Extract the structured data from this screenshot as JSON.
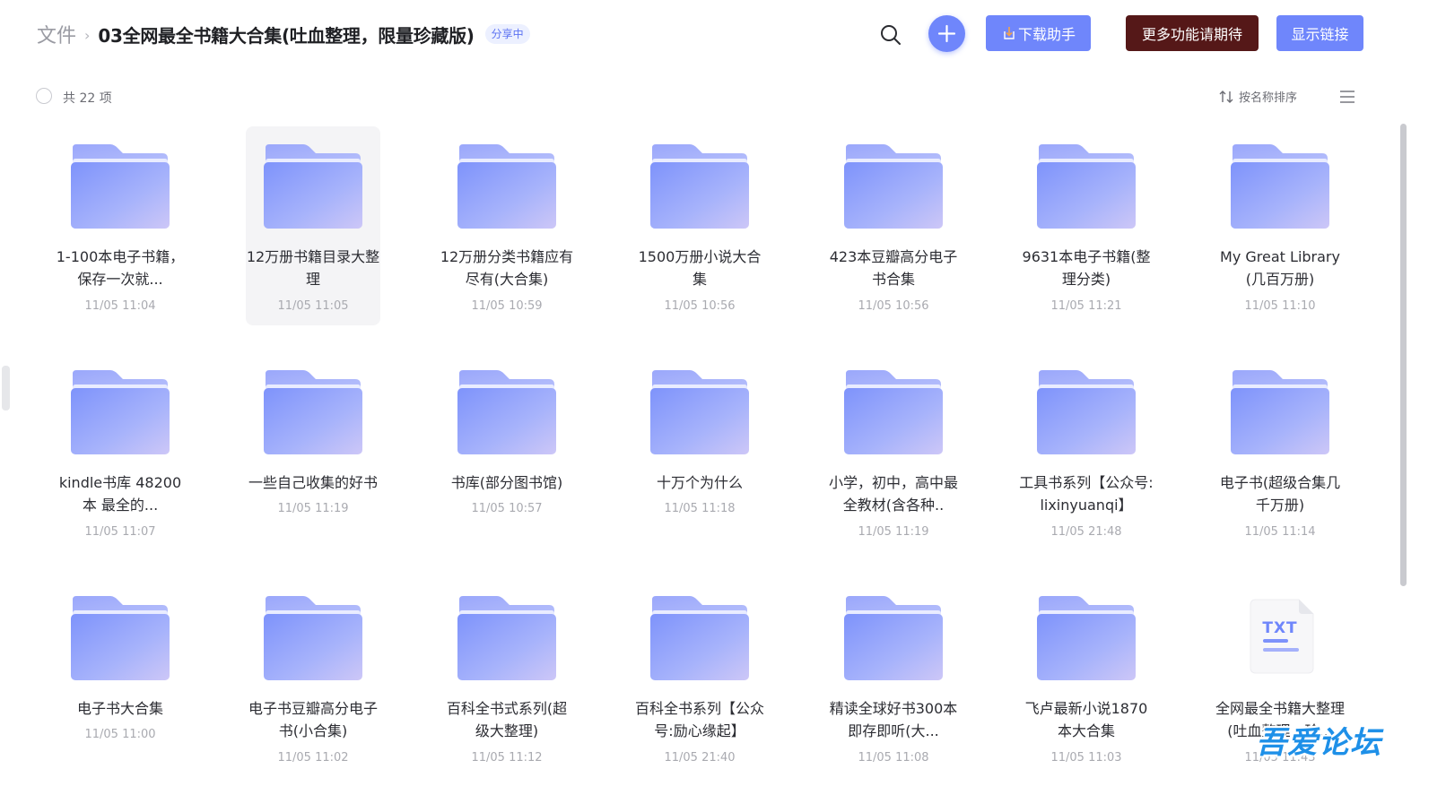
{
  "colors": {
    "accent": "#6f86fb",
    "more_button": "#551818",
    "badge_bg": "#ecf0ff",
    "badge_text": "#5c72f2",
    "folder_light": "#a5b1fb",
    "folder_front": "#7d92fb"
  },
  "breadcrumb": {
    "root": "文件",
    "separator": "›",
    "current": "03全网最全书籍大合集(吐血整理，限量珍藏版)",
    "badge": "分享中"
  },
  "header": {
    "search_icon": "search-icon",
    "add_icon": "plus-icon",
    "download_label": "下载助手",
    "more_label": "更多功能请期待",
    "link_label": "显示链接"
  },
  "toolbar": {
    "total": "共 22 项",
    "sort_label": "按名称排序",
    "sort_icon": "sort-arrows-icon",
    "view_icon": "list-view-icon"
  },
  "items": [
    {
      "name": "1-100本电子书籍，保存一次就...",
      "date": "11/05 11:04",
      "type": "folder"
    },
    {
      "name": "12万册书籍目录大整理",
      "date": "11/05 11:05",
      "type": "folder",
      "selected": true
    },
    {
      "name": "12万册分类书籍应有尽有(大合集)",
      "date": "11/05 10:59",
      "type": "folder"
    },
    {
      "name": "1500万册小说大合集",
      "date": "11/05 10:56",
      "type": "folder"
    },
    {
      "name": "423本豆瓣高分电子书合集",
      "date": "11/05 10:56",
      "type": "folder"
    },
    {
      "name": "9631本电子书籍(整理分类)",
      "date": "11/05 11:21",
      "type": "folder"
    },
    {
      "name": "My Great Library(几百万册)",
      "date": "11/05 11:10",
      "type": "folder"
    },
    {
      "name": "kindle书库 48200本 最全的...",
      "date": "11/05 11:07",
      "type": "folder"
    },
    {
      "name": "一些自己收集的好书",
      "date": "11/05 11:19",
      "type": "folder"
    },
    {
      "name": "书库(部分图书馆)",
      "date": "11/05 10:57",
      "type": "folder"
    },
    {
      "name": "十万个为什么",
      "date": "11/05 11:18",
      "type": "folder"
    },
    {
      "name": "小学，初中，高中最全教材(含各种..",
      "date": "11/05 11:19",
      "type": "folder"
    },
    {
      "name": "工具书系列【公众号:lixinyuanqi】",
      "date": "11/05 21:48",
      "type": "folder"
    },
    {
      "name": "电子书(超级合集几千万册)",
      "date": "11/05 11:14",
      "type": "folder"
    },
    {
      "name": "电子书大合集",
      "date": "11/05 11:00",
      "type": "folder"
    },
    {
      "name": "电子书豆瓣高分电子书(小合集)",
      "date": "11/05 11:02",
      "type": "folder"
    },
    {
      "name": "百科全书式系列(超级大整理)",
      "date": "11/05 11:12",
      "type": "folder"
    },
    {
      "name": "百科全书系列【公众号:励心缘起】",
      "date": "11/05 21:40",
      "type": "folder"
    },
    {
      "name": "精读全球好书300本 即存即听(大...",
      "date": "11/05 11:08",
      "type": "folder"
    },
    {
      "name": "飞卢最新小说1870本大合集",
      "date": "11/05 11:03",
      "type": "folder"
    },
    {
      "name": "全网最全书籍大整理(吐血整理，珍...",
      "date": "11/05 11:43",
      "type": "txt",
      "icon_label": "TXT"
    }
  ],
  "watermark": "吾爱论坛"
}
